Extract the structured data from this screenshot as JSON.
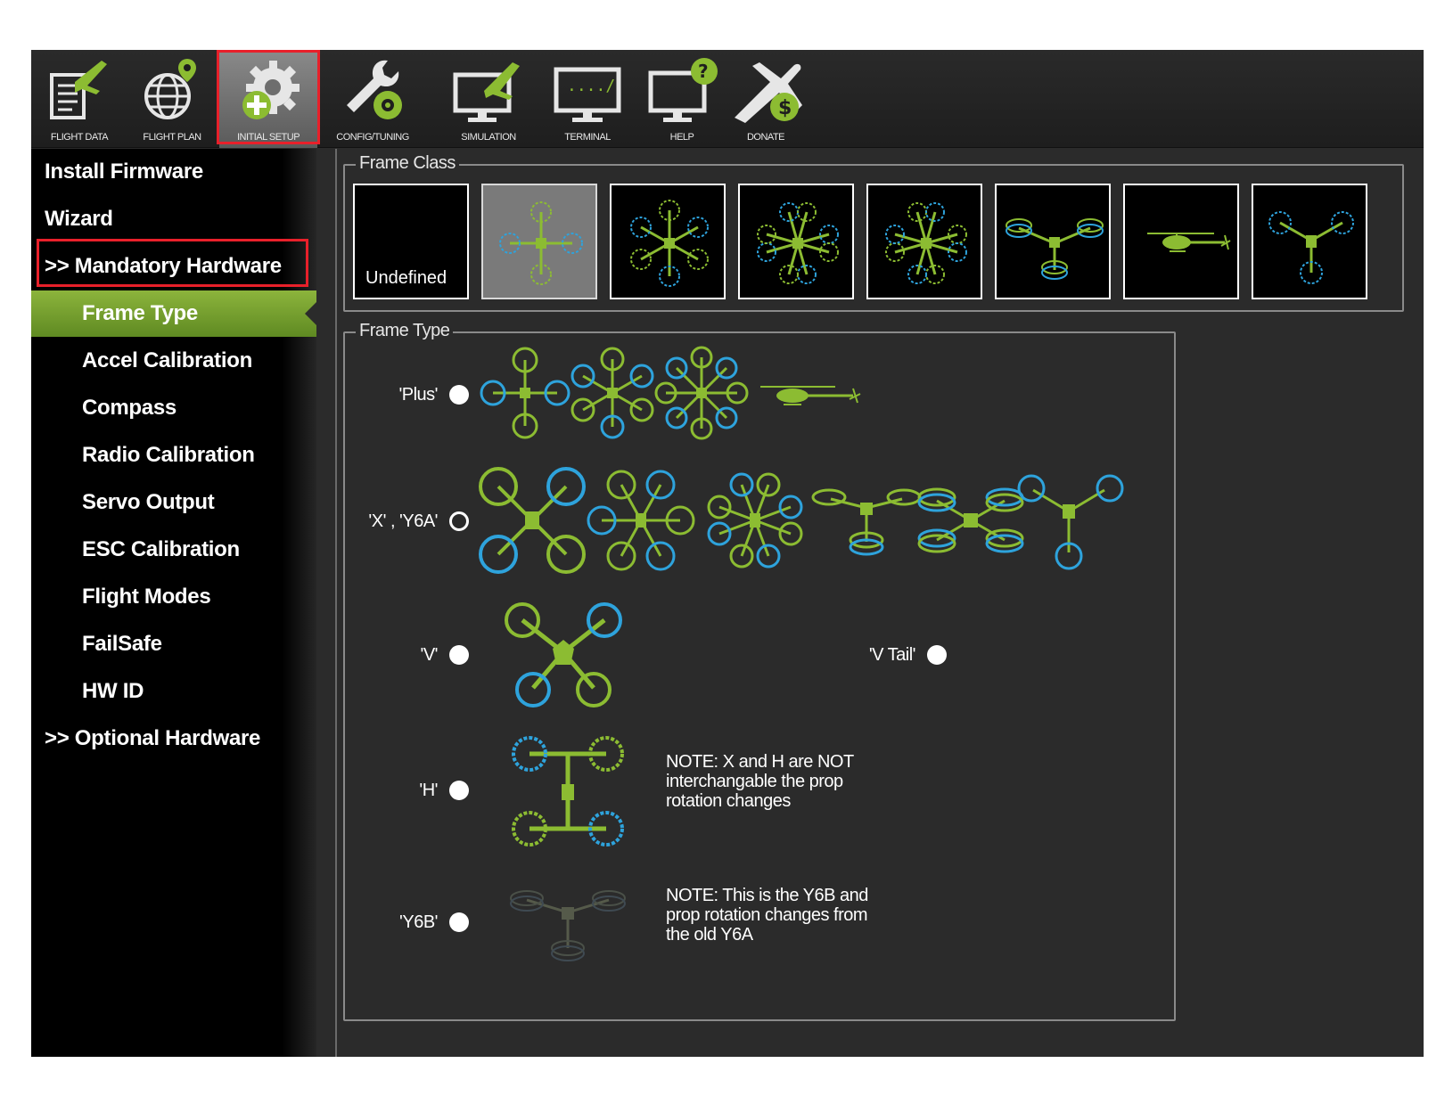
{
  "toolbar": {
    "items": [
      {
        "label": "FLIGHT DATA"
      },
      {
        "label": "FLIGHT PLAN"
      },
      {
        "label": "INITIAL SETUP"
      },
      {
        "label": "CONFIG/TUNING"
      },
      {
        "label": "SIMULATION"
      },
      {
        "label": "TERMINAL"
      },
      {
        "label": "HELP"
      },
      {
        "label": "DONATE"
      }
    ],
    "active": "INITIAL SETUP"
  },
  "sidebar": {
    "items": [
      {
        "label": "Install Firmware"
      },
      {
        "label": "Wizard"
      },
      {
        "label": ">> Mandatory Hardware"
      },
      {
        "label": "Frame Type"
      },
      {
        "label": "Accel Calibration"
      },
      {
        "label": "Compass"
      },
      {
        "label": "Radio Calibration"
      },
      {
        "label": "Servo Output"
      },
      {
        "label": "ESC Calibration"
      },
      {
        "label": "Flight Modes"
      },
      {
        "label": "FailSafe"
      },
      {
        "label": "HW ID"
      },
      {
        "label": ">> Optional Hardware"
      }
    ],
    "selected": "Frame Type"
  },
  "frame_class": {
    "title": "Frame Class",
    "tiles": [
      {
        "label": "Undefined"
      },
      {
        "label": ""
      },
      {
        "label": ""
      },
      {
        "label": ""
      },
      {
        "label": ""
      },
      {
        "label": ""
      },
      {
        "label": ""
      },
      {
        "label": ""
      }
    ]
  },
  "frame_type": {
    "title": "Frame Type",
    "options": [
      {
        "label": "'Plus'"
      },
      {
        "label": "'X' , 'Y6A'"
      },
      {
        "label": "'V'"
      },
      {
        "label": "'V Tail'"
      },
      {
        "label": "'H'"
      },
      {
        "label": "'Y6B'"
      }
    ],
    "selected": "'X' , 'Y6A'",
    "notes": {
      "h_note": "NOTE: X and H are NOT\ninterchangable the prop\nrotation changes",
      "y6b_note": "NOTE: This is the Y6B and\nprop rotation changes from\nthe old Y6A"
    }
  },
  "colors": {
    "accent_green": "#8cbc32",
    "prop_blue": "#2ea3dc",
    "highlight_red": "#e8202a",
    "background": "#2b2b2b"
  },
  "icons": [
    "flight-data-icon",
    "flight-plan-icon",
    "initial-setup-icon",
    "config-tuning-icon",
    "simulation-icon",
    "terminal-icon",
    "help-icon",
    "donate-icon"
  ]
}
